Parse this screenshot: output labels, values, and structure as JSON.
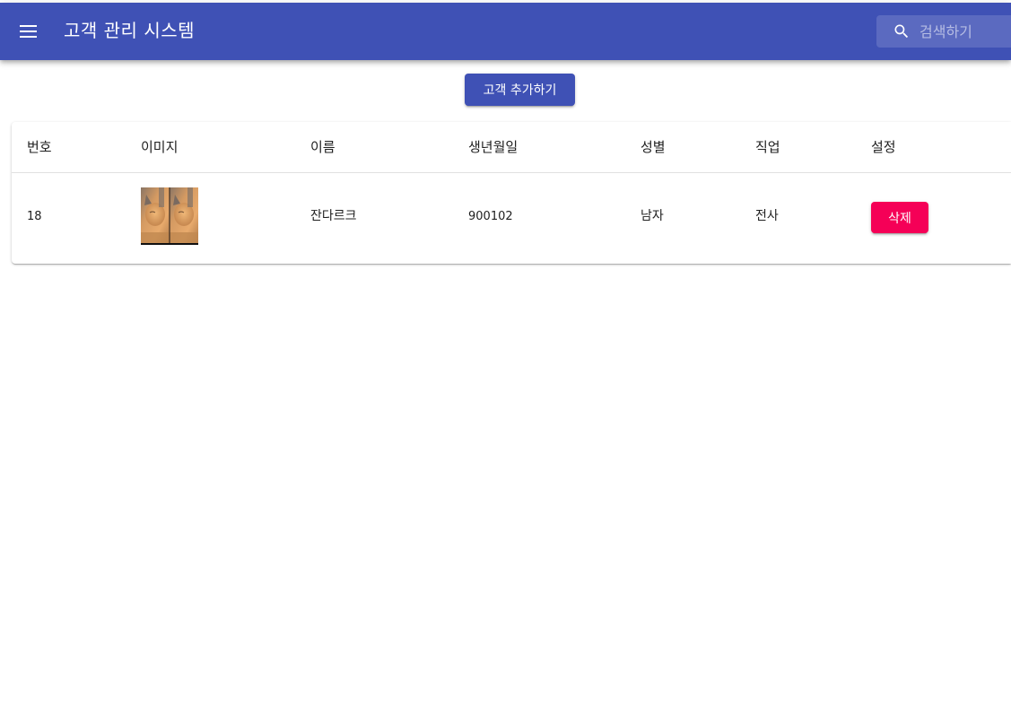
{
  "appbar": {
    "title": "고객 관리 시스템",
    "menu_icon": "menu-icon",
    "search": {
      "icon": "search-icon",
      "placeholder": "검색하기",
      "value": ""
    },
    "color": "#3f51b5"
  },
  "toolbar": {
    "add_label": "고객 추가하기"
  },
  "table": {
    "columns": [
      "번호",
      "이미지",
      "이름",
      "생년월일",
      "성별",
      "직업",
      "설정"
    ],
    "rows": [
      {
        "id": "18",
        "image": "customer-photo",
        "name": "잔다르크",
        "birthday": "900102",
        "gender": "남자",
        "job": "전사",
        "delete_label": "삭제"
      }
    ]
  },
  "colors": {
    "primary": "#3f51b5",
    "secondary": "#f50057"
  }
}
